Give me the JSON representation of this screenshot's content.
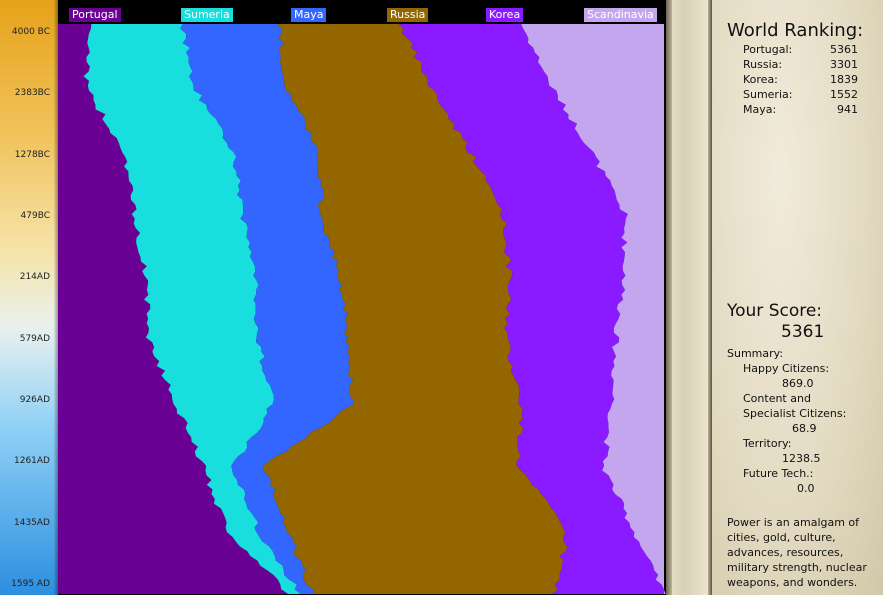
{
  "timeline": {
    "ticks": [
      "4000 BC",
      "2383BC",
      "1278BC",
      "479BC",
      "214AD",
      "579AD",
      "926AD",
      "1261AD",
      "1435AD",
      "1595 AD"
    ]
  },
  "civilizations": [
    {
      "name": "Portugal",
      "color": "#6a0094"
    },
    {
      "name": "Sumeria",
      "color": "#18dede"
    },
    {
      "name": "Maya",
      "color": "#3366ff"
    },
    {
      "name": "Russia",
      "color": "#946600"
    },
    {
      "name": "Korea",
      "color": "#8a1aff"
    },
    {
      "name": "Scandinavia",
      "color": "#c4a6ee"
    }
  ],
  "chart_data": {
    "type": "area",
    "title": "",
    "xlabel": "",
    "ylabel": "",
    "x": [
      "4000 BC",
      "2383BC",
      "1278BC",
      "479BC",
      "214AD",
      "579AD",
      "926AD",
      "1261AD",
      "1435AD",
      "1595 AD"
    ],
    "stacking": "percent",
    "series": [
      {
        "name": "Portugal",
        "values": [
          5.5,
          4.5,
          11,
          12.5,
          14.5,
          15,
          19.5,
          24,
          28,
          38
        ]
      },
      {
        "name": "Sumeria",
        "values": [
          15,
          18,
          18,
          18,
          18,
          18,
          16,
          5,
          5,
          2
        ]
      },
      {
        "name": "Maya",
        "values": [
          16,
          15,
          14,
          13,
          14,
          15,
          13,
          5,
          5,
          2
        ]
      },
      {
        "name": "Russia",
        "values": [
          20,
          24,
          25,
          30,
          28,
          26,
          28,
          42,
          46,
          40
        ]
      },
      {
        "name": "Korea",
        "values": [
          20,
          20,
          20,
          20,
          19,
          18,
          15,
          14,
          11,
          18
        ]
      },
      {
        "name": "Scandinavia",
        "values": [
          23.5,
          18.5,
          12,
          6.5,
          6.5,
          8,
          8.5,
          10,
          5,
          0
        ]
      }
    ]
  },
  "ranking": {
    "title": "World Ranking:",
    "rows": [
      {
        "name": "Portugal:",
        "score": "5361"
      },
      {
        "name": "Russia:",
        "score": "3301"
      },
      {
        "name": "Korea:",
        "score": "1839"
      },
      {
        "name": "Sumeria:",
        "score": "1552"
      },
      {
        "name": "Maya:",
        "score": "941"
      }
    ]
  },
  "score": {
    "title": "Your Score:",
    "value": "5361",
    "summary_label": "Summary:",
    "happy_label": "Happy Citizens:",
    "happy_value": "869.0",
    "content_label_1": "Content and",
    "content_label_2": "Specialist Citizens:",
    "content_value": "68.9",
    "territory_label": "Territory:",
    "territory_value": "1238.5",
    "future_label": "Future Tech.:",
    "future_value": "0.0"
  },
  "description": "Power is an amalgam of cities, gold, culture, advances, resources, military strength, nuclear weapons, and wonders."
}
